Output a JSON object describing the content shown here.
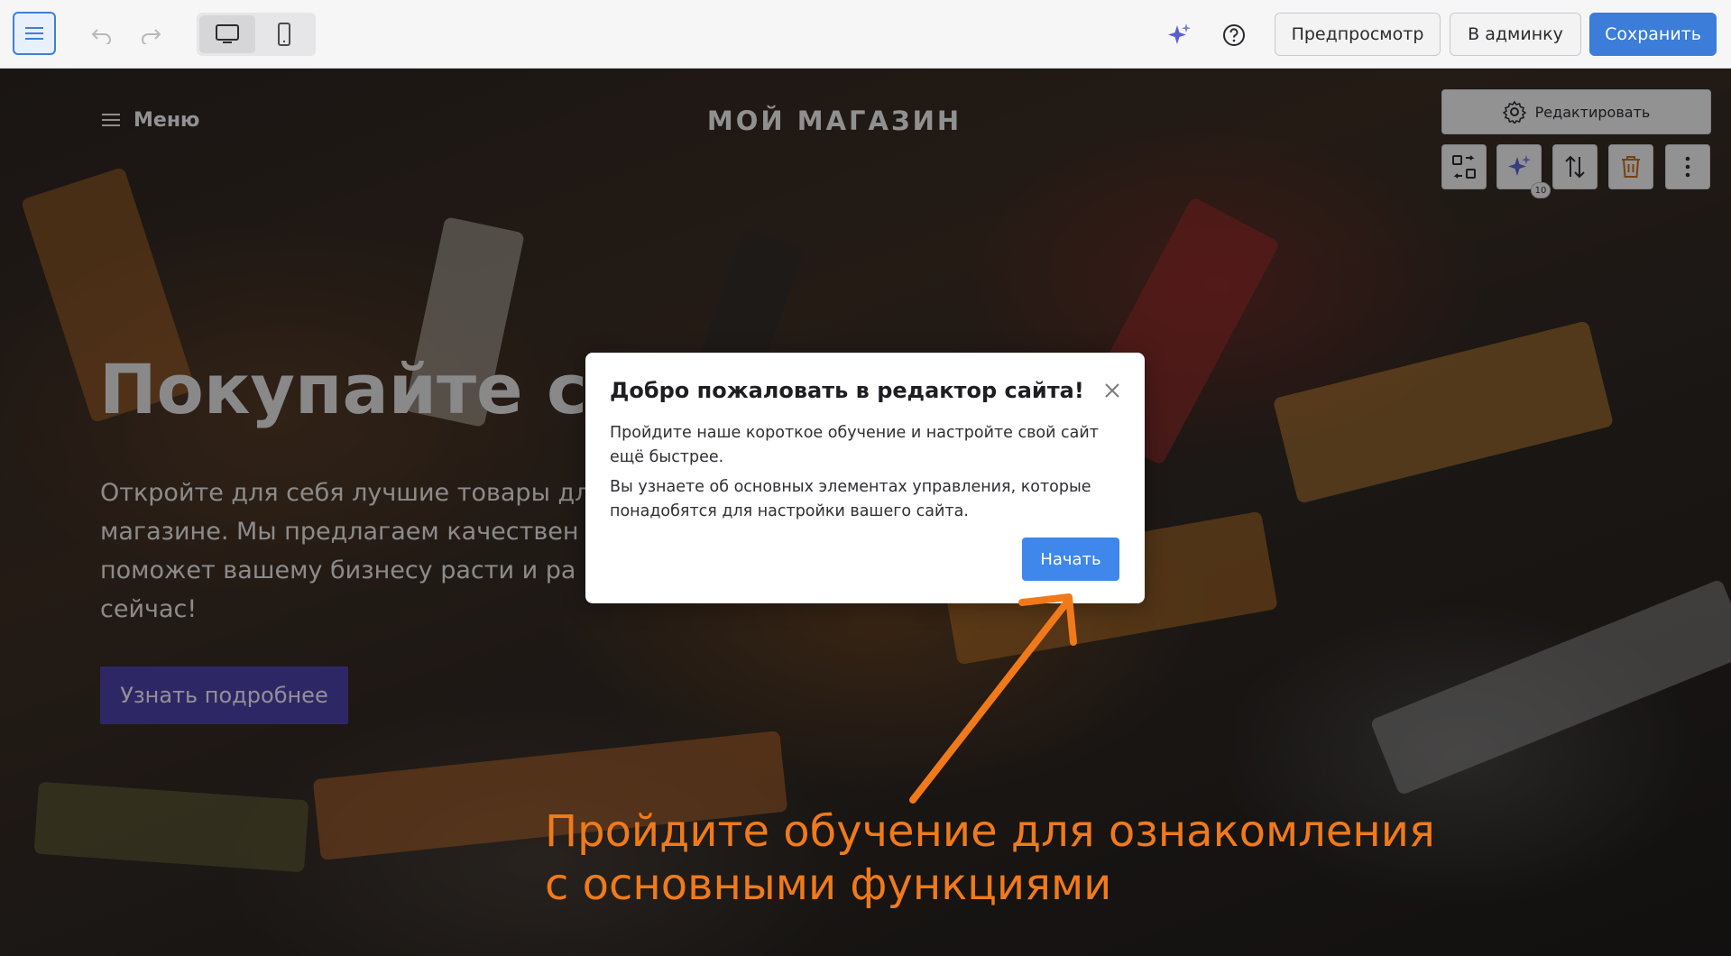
{
  "toolbar": {
    "preview_label": "Предпросмотр",
    "admin_label": "В админку",
    "save_label": "Сохранить"
  },
  "hero": {
    "menu_label": "Меню",
    "logo_text": "МОЙ МАГАЗИН",
    "title": "Покупайте с н",
    "text": "Откройте для себя лучшие товары дл магазине. Мы предлагаем качествен поможет вашему бизнесу расти и ра сейчас!",
    "cta_label": "Узнать подробнее"
  },
  "section_controls": {
    "edit_label": "Редактировать",
    "ai_badge": "10"
  },
  "dialog": {
    "title": "Добро пожаловать в редактор сайта!",
    "paragraph1": "Пройдите наше короткое обучение и настройте свой сайт ещё быстрее.",
    "paragraph2": "Вы узнаете об основных элементах управления, которые понадобятся для настройки вашего сайта.",
    "start_label": "Начать"
  },
  "annotation": {
    "hint": "Пройдите обучение для ознакомления с основными функциями"
  },
  "colors": {
    "accent": "#3b7dd8",
    "cta": "#4b3fa3",
    "annotation": "#f07a1a"
  }
}
